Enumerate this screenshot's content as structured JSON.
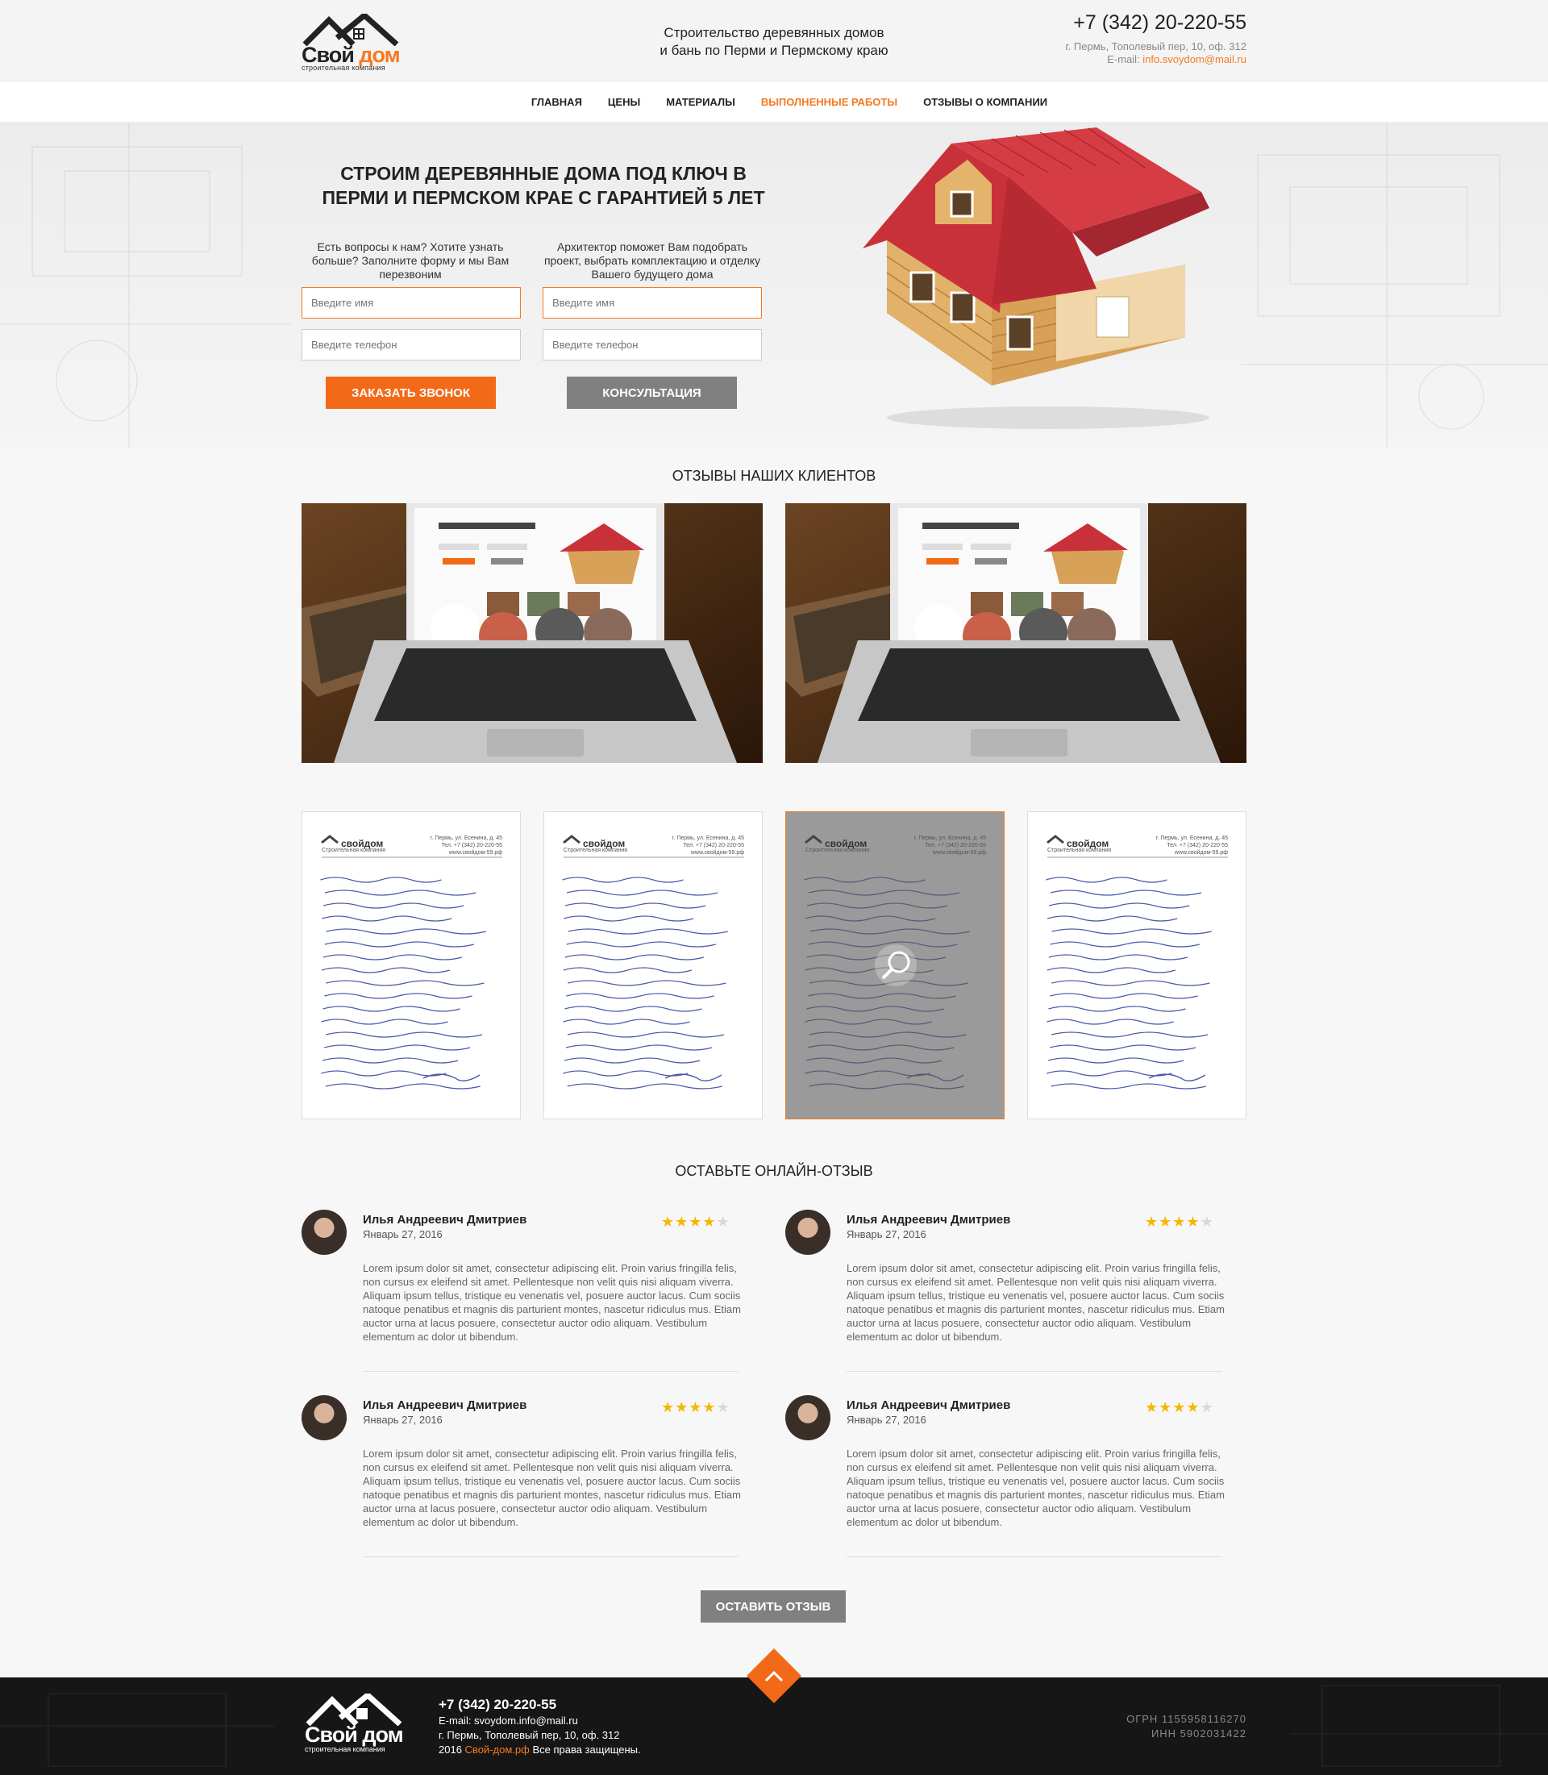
{
  "header": {
    "logo_main": "Свой",
    "logo_accent": "дом",
    "logo_sub": "строительная компания",
    "tagline_1": "Строительство деревянных домов",
    "tagline_2": "и бань по Перми и Пермскому краю",
    "phone": "+7 (342) 20-220-55",
    "address": "г. Пермь, Тополевый пер, 10, оф. 312",
    "email_label": "E-mail:",
    "email": "info.svoydom@mail.ru"
  },
  "nav": {
    "items": [
      "ГЛАВНАЯ",
      "ЦЕНЫ",
      "МАТЕРИАЛЫ",
      "ВЫПОЛНЕННЫЕ РАБОТЫ",
      "ОТЗЫВЫ О КОМПАНИИ"
    ],
    "active_index": 3
  },
  "hero": {
    "title_1": "СТРОИМ ДЕРЕВЯННЫЕ ДОМА ПОД КЛЮЧ В",
    "title_2": "ПЕРМИ И ПЕРМСКОМ КРАЕ С ГАРАНТИЕЙ 5 ЛЕТ",
    "left_intro": "Есть вопросы к нам? Хотите узнать больше? Заполните форму и мы Вам перезвоним",
    "right_intro": "Архитектор поможет Вам подобрать проект, выбрать комплектацию и отделку Вашего будущего дома",
    "name_placeholder": "Введите имя",
    "phone_placeholder": "Введите телефон",
    "callback_button": "ЗАКАЗАТЬ ЗВОНОК",
    "consult_button": "КОНСУЛЬТАЦИЯ"
  },
  "reviews": {
    "title": "ОТЗЫВЫ НАШИХ КЛИЕНТОВ",
    "letter_company": "свойдом",
    "letter_sub": "Строительная компания",
    "letter_addr": "г. Пермь, ул. Есенина, д. 45",
    "letter_phone": "Тел. +7 (342) 20-220-55",
    "letter_site": "www.свойдом-59.рф"
  },
  "online": {
    "title": "ОСТАВЬТЕ ОНЛАЙН-ОТЗЫВ",
    "items": [
      {
        "name": "Илья Андреевич Дмитриев",
        "date": "Январь 27, 2016",
        "rating": 4,
        "text": "Lorem ipsum dolor sit amet, consectetur adipiscing elit. Proin varius fringilla felis, non cursus ex eleifend sit amet. Pellentesque non velit quis nisi aliquam viverra. Aliquam ipsum tellus, tristique eu venenatis vel, posuere auctor lacus. Cum sociis natoque penatibus et magnis dis parturient montes, nascetur ridiculus mus. Etiam auctor urna at lacus posuere, consectetur auctor odio aliquam. Vestibulum elementum ac dolor ut bibendum."
      },
      {
        "name": "Илья Андреевич Дмитриев",
        "date": "Январь 27, 2016",
        "rating": 4,
        "text": "Lorem ipsum dolor sit amet, consectetur adipiscing elit. Proin varius fringilla felis, non cursus ex eleifend sit amet. Pellentesque non velit quis nisi aliquam viverra. Aliquam ipsum tellus, tristique eu venenatis vel, posuere auctor lacus. Cum sociis natoque penatibus et magnis dis parturient montes, nascetur ridiculus mus. Etiam auctor urna at lacus posuere, consectetur auctor odio aliquam. Vestibulum elementum ac dolor ut bibendum."
      },
      {
        "name": "Илья Андреевич Дмитриев",
        "date": "Январь 27, 2016",
        "rating": 4,
        "text": "Lorem ipsum dolor sit amet, consectetur adipiscing elit. Proin varius fringilla felis, non cursus ex eleifend sit amet. Pellentesque non velit quis nisi aliquam viverra. Aliquam ipsum tellus, tristique eu venenatis vel, posuere auctor lacus. Cum sociis natoque penatibus et magnis dis parturient montes, nascetur ridiculus mus. Etiam auctor urna at lacus posuere, consectetur auctor odio aliquam. Vestibulum elementum ac dolor ut bibendum."
      },
      {
        "name": "Илья Андреевич Дмитриев",
        "date": "Январь 27, 2016",
        "rating": 4,
        "text": "Lorem ipsum dolor sit amet, consectetur adipiscing elit. Proin varius fringilla felis, non cursus ex eleifend sit amet. Pellentesque non velit quis nisi aliquam viverra. Aliquam ipsum tellus, tristique eu venenatis vel, posuere auctor lacus. Cum sociis natoque penatibus et magnis dis parturient montes, nascetur ridiculus mus. Etiam auctor urna at lacus posuere, consectetur auctor odio aliquam. Vestibulum elementum ac dolor ut bibendum."
      }
    ],
    "button": "ОСТАВИТЬ ОТЗЫВ"
  },
  "footer": {
    "phone": "+7 (342) 20-220-55",
    "email_line": "E-mail: svoydom.info@mail.ru",
    "address": "г. Пермь, Тополевый пер, 10, оф. 312",
    "copy_year": "2016",
    "copy_site": "Свой-дом.рф",
    "copy_rights": "Все права защищены.",
    "ogrn": "ОГРН 1155958116270",
    "inn": "ИНН 5902031422"
  },
  "colors": {
    "accent": "#f26a18",
    "gray_button": "#808080",
    "star": "#f5b700"
  }
}
